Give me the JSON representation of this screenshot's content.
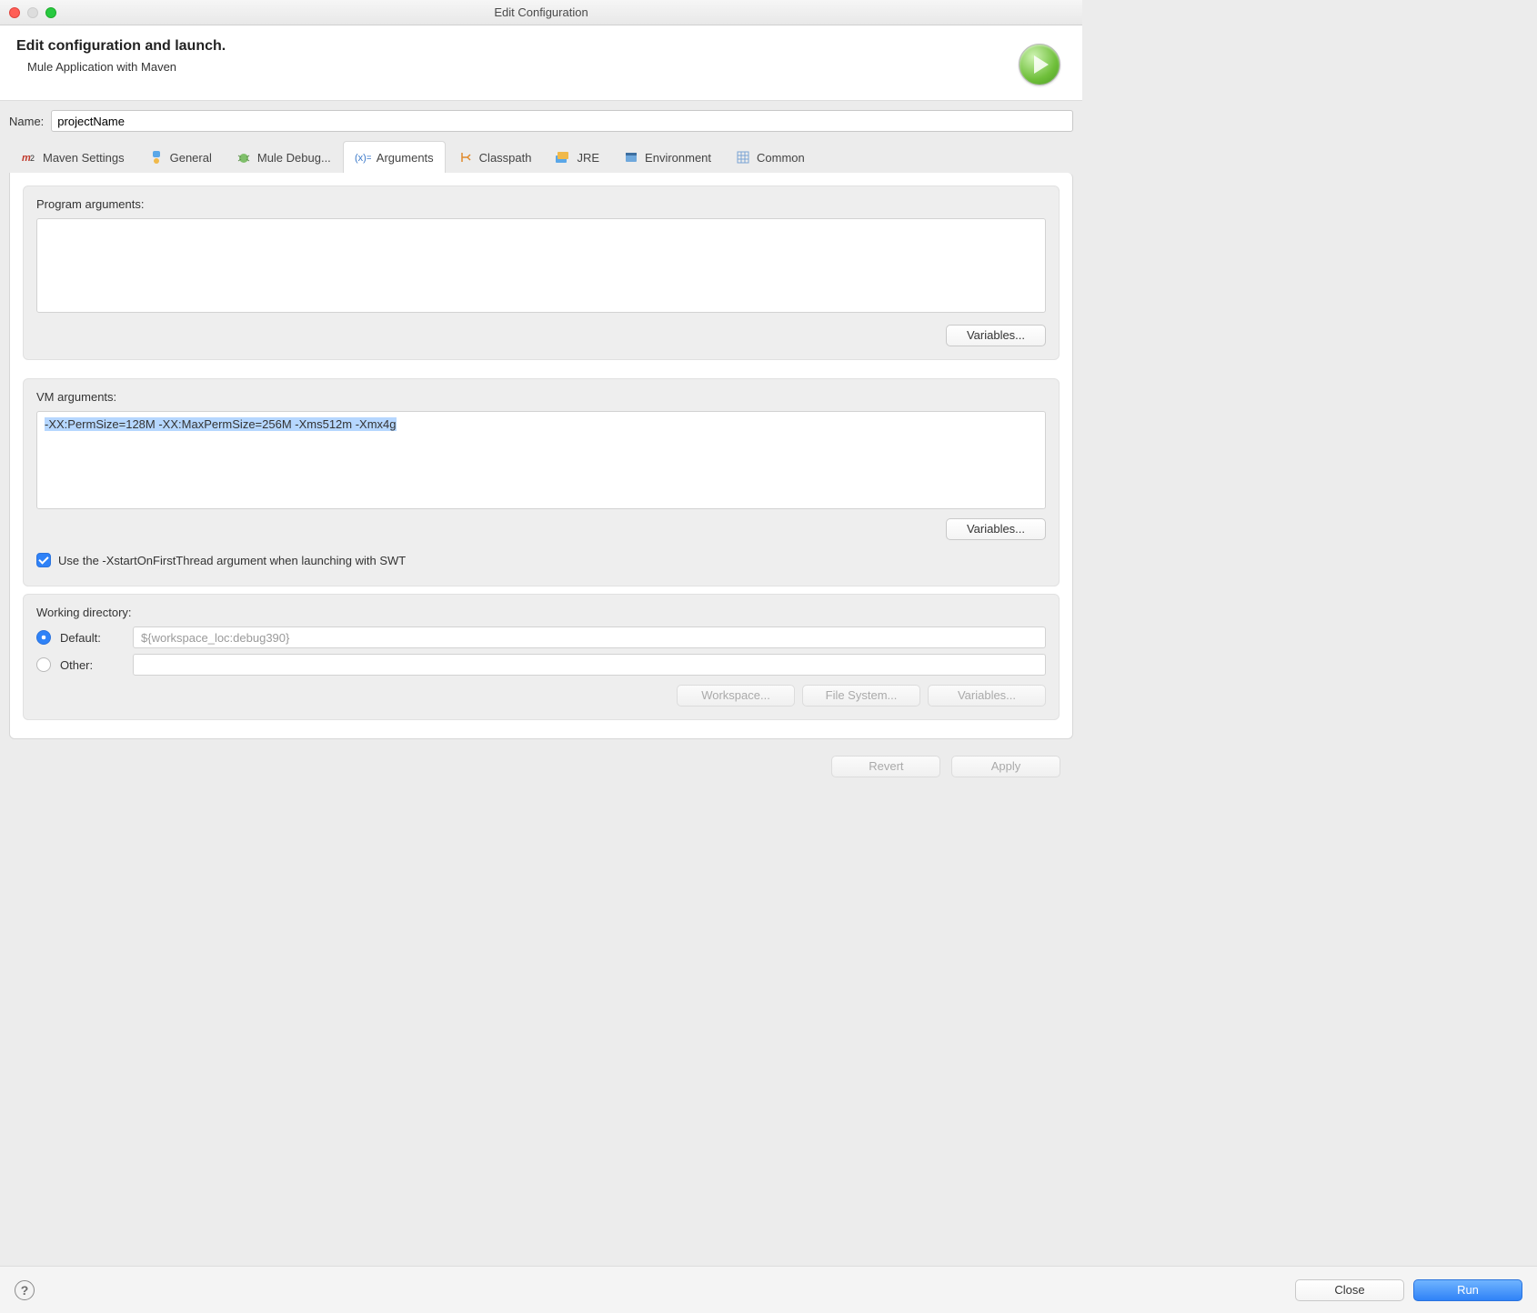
{
  "window": {
    "title": "Edit Configuration"
  },
  "header": {
    "title": "Edit configuration and launch.",
    "subtitle": "Mule Application with Maven"
  },
  "name": {
    "label": "Name:",
    "value": "projectName"
  },
  "tabs": [
    {
      "id": "maven",
      "label": "Maven Settings"
    },
    {
      "id": "general",
      "label": "General"
    },
    {
      "id": "debug",
      "label": "Mule Debug..."
    },
    {
      "id": "args",
      "label": "Arguments",
      "active": true
    },
    {
      "id": "cp",
      "label": "Classpath"
    },
    {
      "id": "jre",
      "label": "JRE"
    },
    {
      "id": "env",
      "label": "Environment"
    },
    {
      "id": "common",
      "label": "Common"
    }
  ],
  "program_args": {
    "label": "Program arguments:",
    "value": "",
    "variables_btn": "Variables..."
  },
  "vm_args": {
    "label": "VM arguments:",
    "value": "-XX:PermSize=128M -XX:MaxPermSize=256M -Xms512m -Xmx4g",
    "variables_btn": "Variables..."
  },
  "swt_checkbox": {
    "checked": true,
    "label": "Use the -XstartOnFirstThread argument when launching with SWT"
  },
  "working_dir": {
    "label": "Working directory:",
    "default_label": "Default:",
    "default_value": "${workspace_loc:debug390}",
    "other_label": "Other:",
    "other_value": "",
    "selected": "default",
    "buttons": {
      "workspace": "Workspace...",
      "filesystem": "File System...",
      "variables": "Variables..."
    }
  },
  "footer": {
    "revert": "Revert",
    "apply": "Apply"
  },
  "bottom": {
    "close": "Close",
    "run": "Run"
  }
}
